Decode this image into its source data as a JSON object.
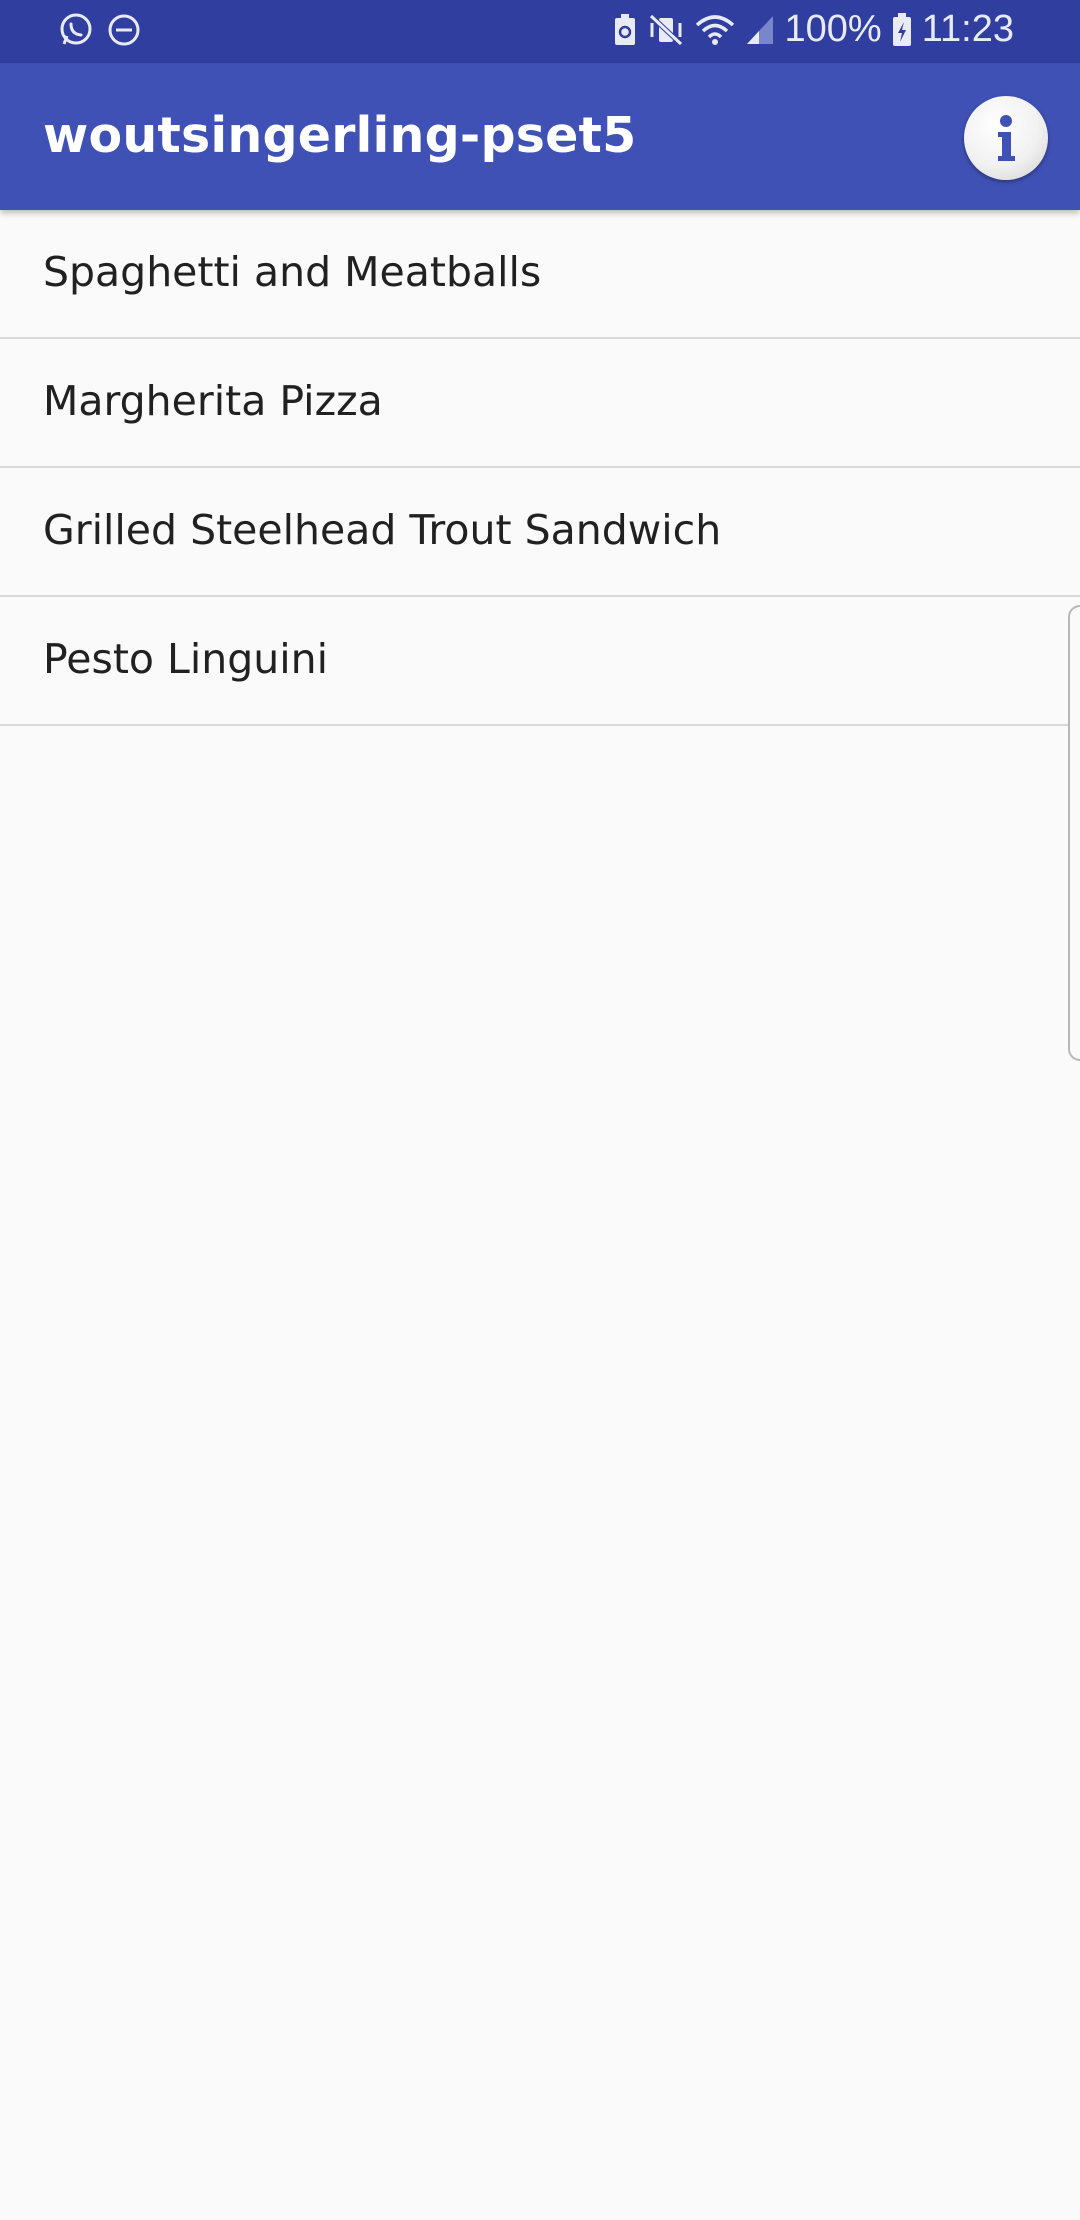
{
  "status_bar": {
    "battery_percent": "100%",
    "time": "11:23",
    "left_icons": [
      "whatsapp-icon",
      "do-not-disturb-icon"
    ],
    "right_icons": [
      "battery-saver-icon",
      "vibrate-mute-icon",
      "wifi-icon",
      "signal-icon",
      "battery-charging-icon"
    ]
  },
  "app_bar": {
    "title": "woutsingerling-pset5",
    "action_icon": "info-icon"
  },
  "list": {
    "items": [
      {
        "label": "Spaghetti and Meatballs"
      },
      {
        "label": "Margherita Pizza"
      },
      {
        "label": "Grilled Steelhead Trout Sandwich"
      },
      {
        "label": "Pesto Linguini"
      }
    ]
  },
  "colors": {
    "status_bar": "#303f9f",
    "app_bar": "#3f51b5",
    "background": "#fafafa",
    "divider": "#d9d9d9",
    "text_primary": "#212121"
  }
}
